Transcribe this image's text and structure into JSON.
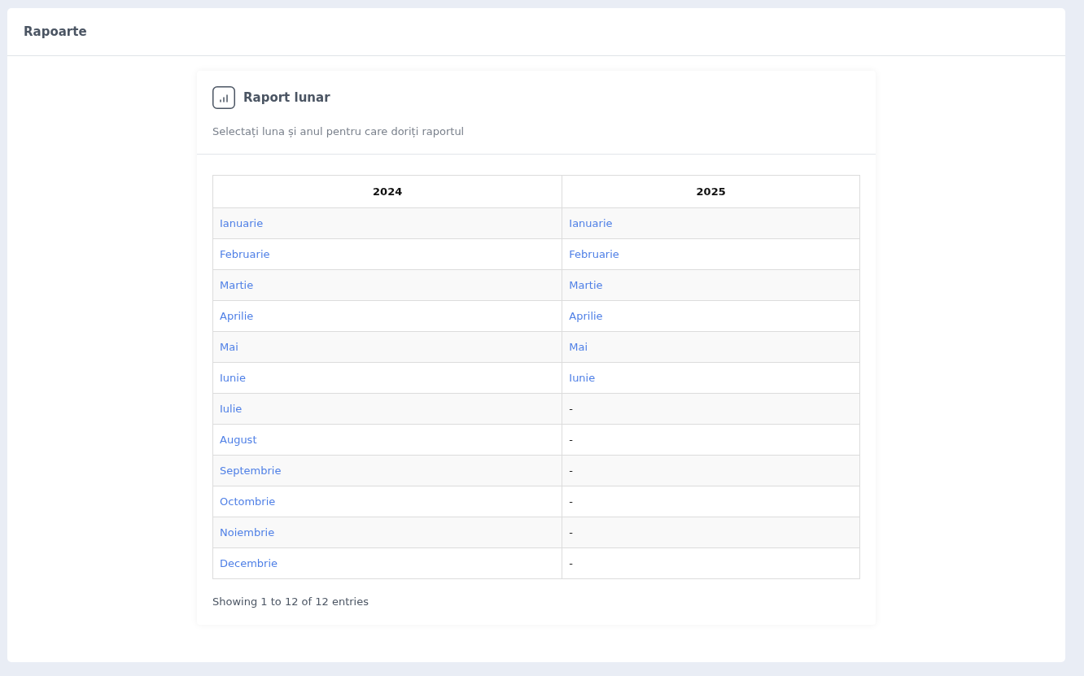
{
  "page": {
    "title": "Rapoarte"
  },
  "card": {
    "title": "Raport lunar",
    "subtitle": "Selectați luna și anul pentru care doriți raportul"
  },
  "table": {
    "columns": [
      "2024",
      "2025"
    ],
    "rows": [
      [
        {
          "kind": "link",
          "text": "Ianuarie"
        },
        {
          "kind": "link",
          "text": "Ianuarie"
        }
      ],
      [
        {
          "kind": "link",
          "text": "Februarie"
        },
        {
          "kind": "link",
          "text": "Februarie"
        }
      ],
      [
        {
          "kind": "link",
          "text": "Martie"
        },
        {
          "kind": "link",
          "text": "Martie"
        }
      ],
      [
        {
          "kind": "link",
          "text": "Aprilie"
        },
        {
          "kind": "link",
          "text": "Aprilie"
        }
      ],
      [
        {
          "kind": "link",
          "text": "Mai"
        },
        {
          "kind": "link",
          "text": "Mai"
        }
      ],
      [
        {
          "kind": "link",
          "text": "Iunie"
        },
        {
          "kind": "link",
          "text": "Iunie"
        }
      ],
      [
        {
          "kind": "link",
          "text": "Iulie"
        },
        {
          "kind": "text",
          "text": "-"
        }
      ],
      [
        {
          "kind": "link",
          "text": "August"
        },
        {
          "kind": "text",
          "text": "-"
        }
      ],
      [
        {
          "kind": "link",
          "text": "Septembrie"
        },
        {
          "kind": "text",
          "text": "-"
        }
      ],
      [
        {
          "kind": "link",
          "text": "Octombrie"
        },
        {
          "kind": "text",
          "text": "-"
        }
      ],
      [
        {
          "kind": "link",
          "text": "Noiembrie"
        },
        {
          "kind": "text",
          "text": "-"
        }
      ],
      [
        {
          "kind": "link",
          "text": "Decembrie"
        },
        {
          "kind": "text",
          "text": "-"
        }
      ]
    ],
    "info": "Showing 1 to 12 of 12 entries"
  }
}
